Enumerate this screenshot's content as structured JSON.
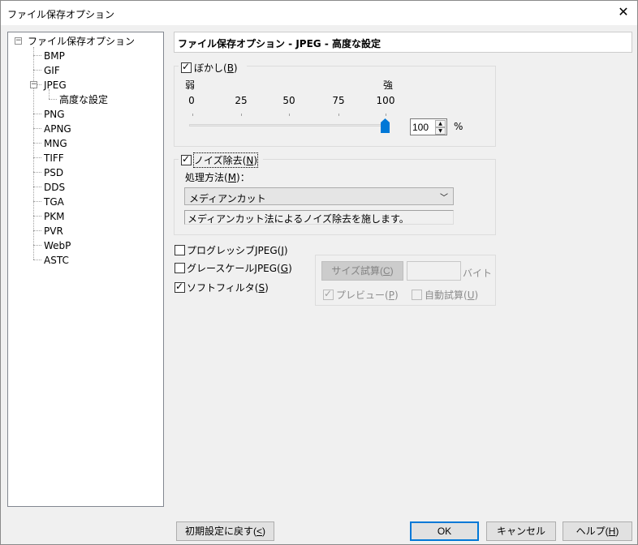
{
  "window": {
    "title": "ファイル保存オプション",
    "close_glyph": "✕"
  },
  "tree": {
    "root": "ファイル保存オプション",
    "items": [
      "BMP",
      "GIF",
      "JPEG",
      "高度な設定",
      "PNG",
      "APNG",
      "MNG",
      "TIFF",
      "PSD",
      "DDS",
      "TGA",
      "PKM",
      "PVR",
      "WebP",
      "ASTC"
    ],
    "selected": "高度な設定"
  },
  "header": {
    "title": "ファイル保存オプション - JPEG - 高度な設定"
  },
  "blur": {
    "label": "ぼかし(",
    "mnemonic": "B",
    "label_end": ")",
    "checked": true,
    "weak_label": "弱",
    "strong_label": "強",
    "ticks": [
      "0",
      "25",
      "50",
      "75",
      "100"
    ],
    "value": 100,
    "value_text": "100",
    "unit": "%"
  },
  "noise": {
    "label": "ノイズ除去(",
    "mnemonic": "N",
    "label_end": ")",
    "checked": true,
    "method_label": "処理方法(",
    "method_mnemonic": "M",
    "method_label_end": ")：",
    "method_value": "メディアンカット",
    "description": "メディアンカット法によるノイズ除去を施します。"
  },
  "options": {
    "progressive": {
      "label": "プログレッシブJPEG(",
      "mnemonic": "J",
      "end": ")",
      "checked": false
    },
    "grayscale": {
      "label": "グレースケールJPEG(",
      "mnemonic": "G",
      "end": ")",
      "checked": false
    },
    "soft_filter": {
      "label": "ソフトフィルタ(",
      "mnemonic": "S",
      "end": ")",
      "checked": true
    }
  },
  "size_test": {
    "button": "サイズ試算(",
    "button_mnemonic": "C",
    "button_end": ")",
    "size_value": "",
    "unit": "バイト",
    "preview": {
      "label": "プレビュー(",
      "mnemonic": "P",
      "end": ")",
      "checked": true
    },
    "auto": {
      "label": "自動試算(",
      "mnemonic": "U",
      "end": ")",
      "checked": false
    }
  },
  "buttons": {
    "reset": "初期設定に戻す(",
    "reset_mnemonic": "<",
    "reset_end": ")",
    "ok": "OK",
    "cancel": "キャンセル",
    "help": "ヘルプ(",
    "help_mnemonic": "H",
    "help_end": ")"
  },
  "colors": {
    "accent": "#0078d7",
    "thumb": "#0078d7"
  }
}
